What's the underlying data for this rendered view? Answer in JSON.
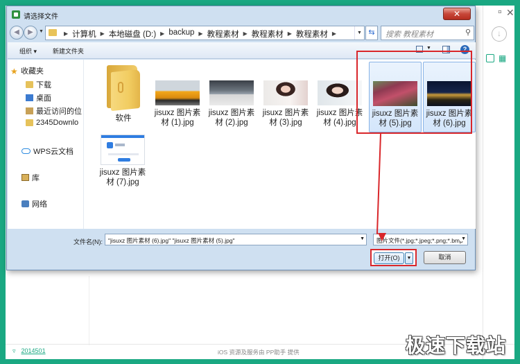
{
  "app": {
    "footer_version": "2014501",
    "footer_text": "iOS 资源及服务由 PP助手 提供",
    "watermark": "极速下载站"
  },
  "dialog": {
    "title": "请选择文件",
    "close_label": "✕",
    "breadcrumbs": [
      "计算机",
      "本地磁盘 (D:)",
      "backup",
      "教程素材",
      "教程素材",
      "教程素材"
    ],
    "search_placeholder": "搜索 教程素材",
    "toolbar": {
      "organize": "组织 ▾",
      "new_folder": "新建文件夹"
    },
    "nav": {
      "favorites": "收藏夹",
      "downloads": "下载",
      "desktop": "桌面",
      "recent": "最近访问的位",
      "folder_2345": "2345Downlo",
      "wps": "WPS云文档",
      "library": "库",
      "network": "网络"
    },
    "files": [
      {
        "label": "软件"
      },
      {
        "label": "jisuxz 图片素材 (1).jpg"
      },
      {
        "label": "jisuxz 图片素材 (2).jpg"
      },
      {
        "label": "jisuxz 图片素材 (3).jpg"
      },
      {
        "label": "jisuxz 图片素材 (4).jpg"
      },
      {
        "label": "jisuxz 图片素材 (5).jpg"
      },
      {
        "label": "jisuxz 图片素材 (6).jpg"
      },
      {
        "label": "jisuxz 图片素材 (7).jpg"
      }
    ],
    "filename_label": "文件名(N):",
    "filename_value": "\"jisuxz 图片素材 (6).jpg\" \"jisuxz 图片素材 (5).jpg\"",
    "filetype_value": "图片文件(*.jpg;*.jpeg;*.png;*.bmp",
    "open_label": "打开(O)",
    "cancel_label": "取消"
  },
  "colors": {
    "background": "#1aa882",
    "annotation": "#d9262a"
  }
}
